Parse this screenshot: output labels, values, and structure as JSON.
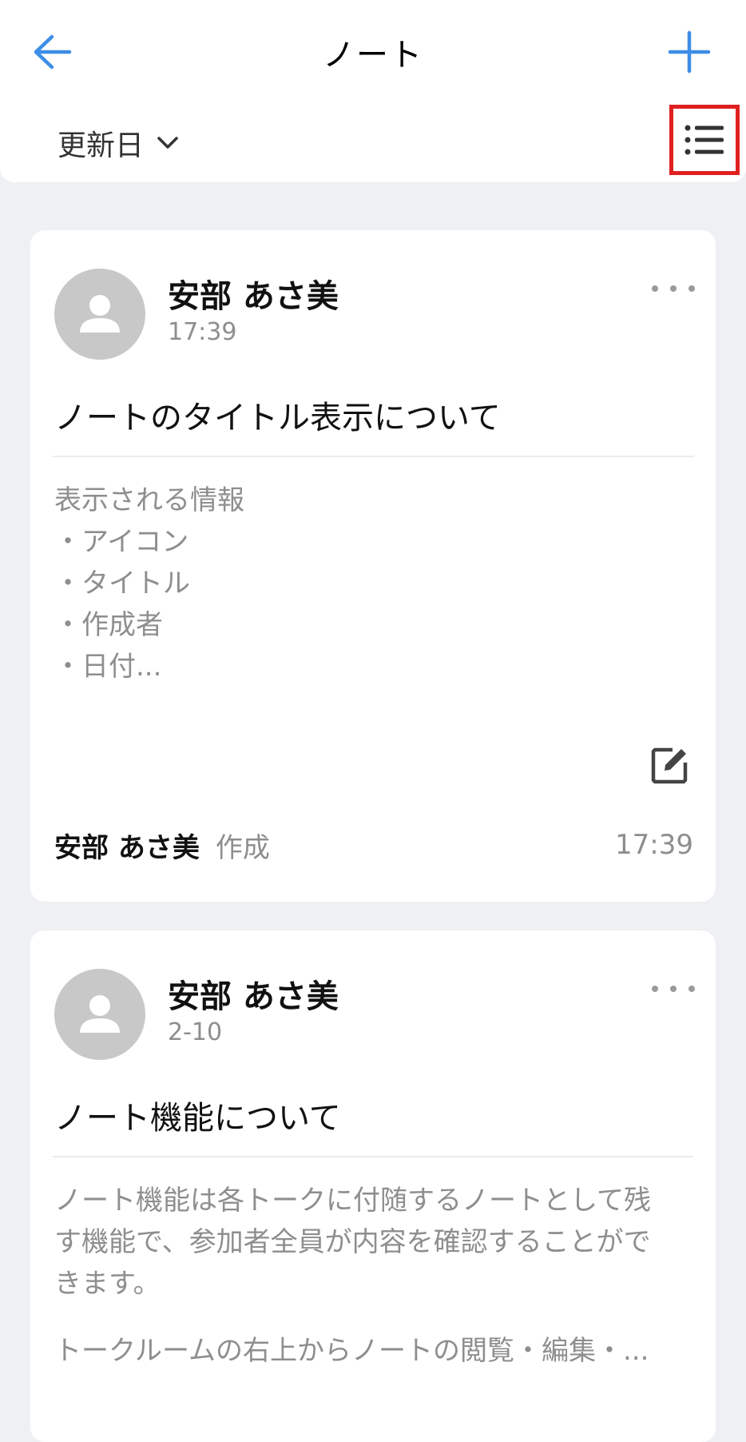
{
  "header": {
    "title": "ノート",
    "back_icon": "arrow-left-icon",
    "add_icon": "plus-icon",
    "accent_color": "#3d8ee6"
  },
  "sortbar": {
    "sort_label": "更新日",
    "chevron_icon": "chevron-down-icon",
    "view_toggle_icon": "list-view-icon",
    "highlight_color": "#e02020"
  },
  "notes": [
    {
      "author": "安部 あさ美",
      "timestamp": "17:39",
      "title": "ノートのタイトル表示について",
      "body_lines": [
        "表示される情報",
        "・アイコン",
        "・タイトル",
        "・作成者",
        "・日付..."
      ],
      "footer_author": "安部 あさ美",
      "footer_action": "作成",
      "footer_time": "17:39",
      "edit_icon": "edit-icon"
    },
    {
      "author": "安部 あさ美",
      "timestamp": "2-10",
      "title": "ノート機能について",
      "body_para1_lines": [
        "ノート機能は各トークに付随するノートとして残",
        "す機能で、参加者全員が内容を確認することがで",
        "きます。"
      ],
      "body_para2": "トークルームの右上からノートの閲覧・編集・..."
    }
  ]
}
